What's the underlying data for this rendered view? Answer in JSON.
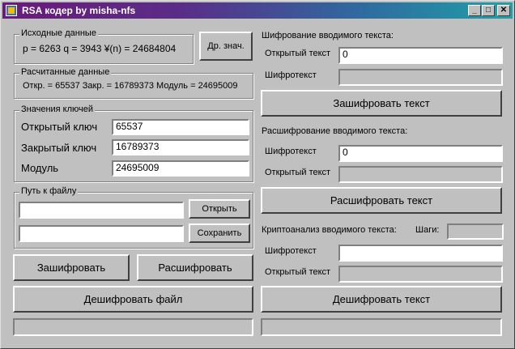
{
  "window": {
    "title": "RSA кодер by misha-nfs",
    "minimize": "_",
    "maximize": "□",
    "close": "✕"
  },
  "source_group": {
    "label": "Исходные данные",
    "values": "p = 6263  q = 3943  ¥(n) = 24684804",
    "other_button": "Др. знач."
  },
  "calc_group": {
    "label": "Расчитанные данные",
    "values": "Откр. = 65537  Закр. = 16789373  Модуль = 24695009"
  },
  "keys_group": {
    "label": "Значения ключей",
    "public_label": "Открытый ключ",
    "public_value": "65537",
    "private_label": "Закрытый ключ",
    "private_value": "16789373",
    "modulus_label": "Модуль",
    "modulus_value": "24695009"
  },
  "file_group": {
    "label": "Путь к файлу",
    "open_path": "",
    "save_path": "",
    "open_button": "Открыть",
    "save_button": "Сохранить"
  },
  "left_buttons": {
    "encrypt": "Зашифровать",
    "decrypt": "Расшифровать",
    "decrypt_file": "Дешифровать файл"
  },
  "encrypt_section": {
    "heading": "Шифрование вводимого текста:",
    "open_label": "Открытый текст",
    "open_value": "0",
    "cipher_label": "Шифротекст",
    "cipher_value": "",
    "button": "Зашифровать текст"
  },
  "decrypt_section": {
    "heading": "Расшифрование вводимого текста:",
    "cipher_label": "Шифротекст",
    "cipher_value": "0",
    "open_label": "Открытый текст",
    "open_value": "",
    "button": "Расшифровать текст"
  },
  "crypto_section": {
    "heading": "Криптоанализ вводимого текста:",
    "steps_label": "Шаги:",
    "steps_value": "",
    "cipher_label": "Шифротекст",
    "cipher_value": "",
    "open_label": "Открытый текст",
    "open_value": "",
    "button": "Дешифровать текст"
  },
  "status": {
    "left": "",
    "right": ""
  }
}
